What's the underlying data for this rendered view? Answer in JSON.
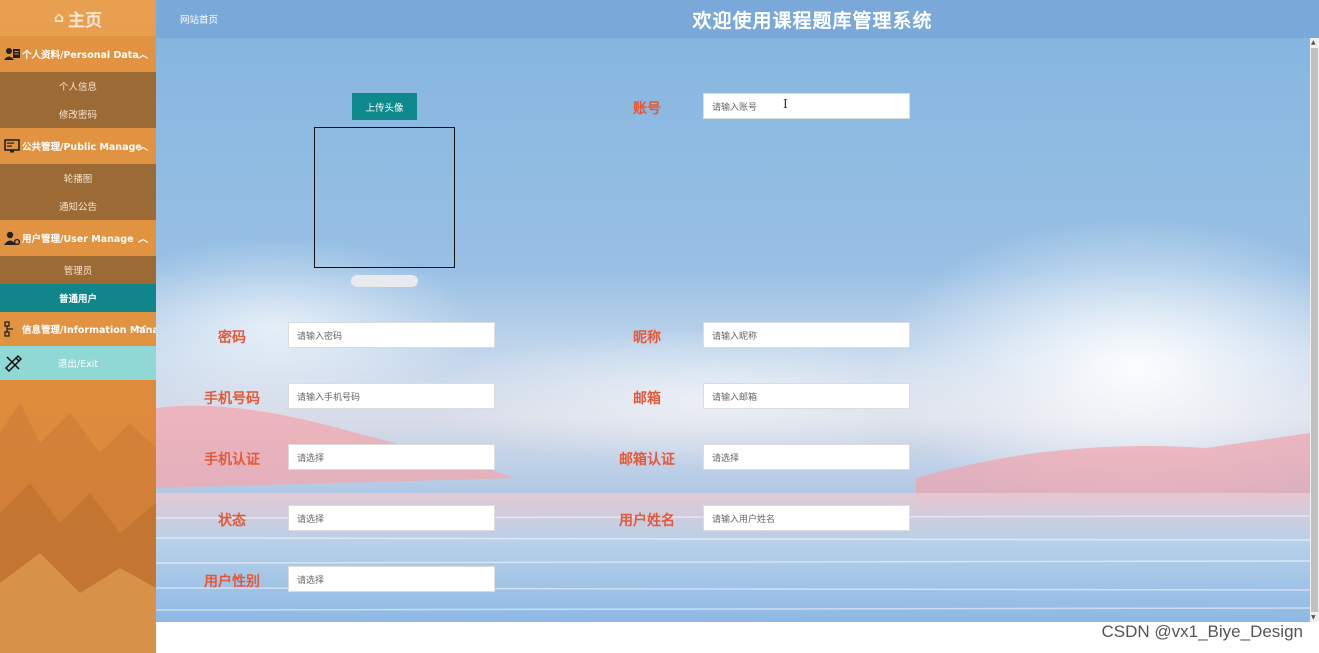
{
  "sidebar": {
    "home": "主页",
    "groups": [
      {
        "label": "个人资料/Personal Data",
        "icon": "user-card-icon",
        "items": [
          "个人信息",
          "修改密码"
        ]
      },
      {
        "label": "公共管理/Public Manage",
        "icon": "monitor-icon",
        "items": [
          "轮播图",
          "通知公告"
        ]
      },
      {
        "label": "用户管理/User Manage",
        "icon": "user-gear-icon",
        "items": [
          "管理员",
          "普通用户"
        ]
      }
    ],
    "info_group": "信息管理/Information Manage",
    "exit": "退出/Exit",
    "active_item": "普通用户"
  },
  "topbar": {
    "crumb": "网站首页",
    "title": "欢迎使用课程题库管理系统"
  },
  "form": {
    "upload_label": "上传头像",
    "account": {
      "label": "账号",
      "placeholder": "请输入账号"
    },
    "password": {
      "label": "密码",
      "placeholder": "请输入密码"
    },
    "nickname": {
      "label": "昵称",
      "placeholder": "请输入昵称"
    },
    "phone": {
      "label": "手机号码",
      "placeholder": "请输入手机号码"
    },
    "email": {
      "label": "邮箱",
      "placeholder": "请输入邮箱"
    },
    "phone_verify": {
      "label": "手机认证",
      "placeholder": "请选择"
    },
    "email_verify": {
      "label": "邮箱认证",
      "placeholder": "请选择"
    },
    "status": {
      "label": "状态",
      "placeholder": "请选择"
    },
    "real_name": {
      "label": "用户姓名",
      "placeholder": "请输入用户姓名"
    },
    "gender": {
      "label": "用户性别",
      "placeholder": "请选择"
    }
  },
  "watermark": "CSDN @vx1_Biye_Design",
  "colors": {
    "sidebar": "#e08c3c",
    "sidebar_sub": "#9c6a34",
    "active": "#10868a",
    "exit": "#8fd8d6",
    "topbar": "#7aa9d9",
    "label": "#e25a3a",
    "button": "#0f8a8c"
  }
}
